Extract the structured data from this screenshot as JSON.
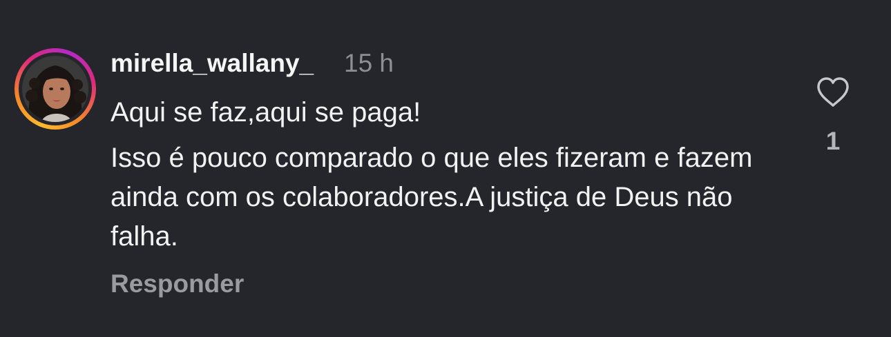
{
  "comment": {
    "username": "mirella_wallany_",
    "timestamp": "15 h",
    "text_line1": "Aqui se faz,aqui se paga!",
    "text_body": "Isso é pouco comparado o que eles fizeram e fazem ainda com os colaboradores.A justiça de Deus não falha.",
    "reply_label": "Responder",
    "like_count": "1"
  },
  "icons": {
    "like": "heart-outline-icon",
    "avatar": "profile-photo"
  },
  "colors": {
    "background": "#25262b",
    "text": "#f2f2f2",
    "muted": "#8e8e93",
    "story_ring_start": "#fdbb2d",
    "story_ring_end": "#dd2a7b"
  }
}
